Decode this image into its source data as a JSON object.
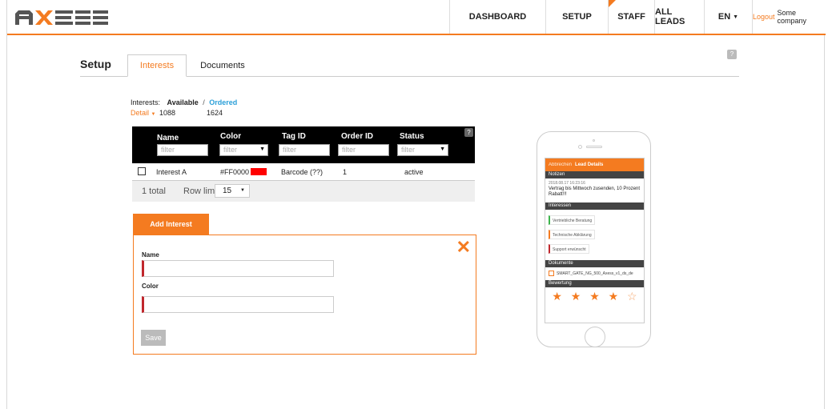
{
  "brand": {
    "name": "AXESS",
    "accent": "#f47b20"
  },
  "nav": {
    "dashboard": "DASHBOARD",
    "setup": "SETUP",
    "staff": "STAFF",
    "all_leads": "ALL LEADS",
    "lang": "EN",
    "logout": "Logout",
    "company": "Some company"
  },
  "page": {
    "title": "Setup",
    "tabs": [
      {
        "label": "Interests",
        "active": true
      },
      {
        "label": "Documents",
        "active": false
      }
    ],
    "help": "?"
  },
  "summary": {
    "label": "Interests:",
    "available_label": "Available",
    "separator": "/",
    "ordered_label": "Ordered",
    "detail_label": "Detail",
    "available_count": "1088",
    "ordered_count": "1624"
  },
  "table": {
    "columns": [
      "Name",
      "Color",
      "Tag ID",
      "Order ID",
      "Status"
    ],
    "filter_placeholder": "filter",
    "help": "?",
    "rows": [
      {
        "name": "Interest A",
        "color": "#FF0000",
        "tag_id": "Barcode  (??)",
        "order_id": "1",
        "status": "active"
      }
    ],
    "footer": {
      "total": "1 total",
      "row_limit_label": "Row limit:",
      "row_limit_value": "15"
    }
  },
  "add_interest": {
    "tab_label": "Add Interest",
    "name_label": "Name",
    "color_label": "Color",
    "name_value": "",
    "color_value": "",
    "save_label": "Save"
  },
  "phone": {
    "cancel": "Abbrechen",
    "title": "Lead Details",
    "notes_header": "Notizen",
    "note_date": "2018.08.17 16:23:16",
    "note_text": "Vertrag bis Mittwoch zusenden, 10 Prozent Rabatt!!!",
    "interests_header": "Interessen",
    "interests": [
      {
        "label": "Vertriebliche Beratung",
        "color": "#3cb44b"
      },
      {
        "label": "Technische Abklärung",
        "color": "#f47b20"
      },
      {
        "label": "Support erwünscht",
        "color": "#c0272d"
      }
    ],
    "documents_header": "Dokumente",
    "document_name": "SMART_GATE_NG_500_Axess_v1_ds_de",
    "rating_header": "Bewertung",
    "rating": 4,
    "rating_max": 5
  }
}
